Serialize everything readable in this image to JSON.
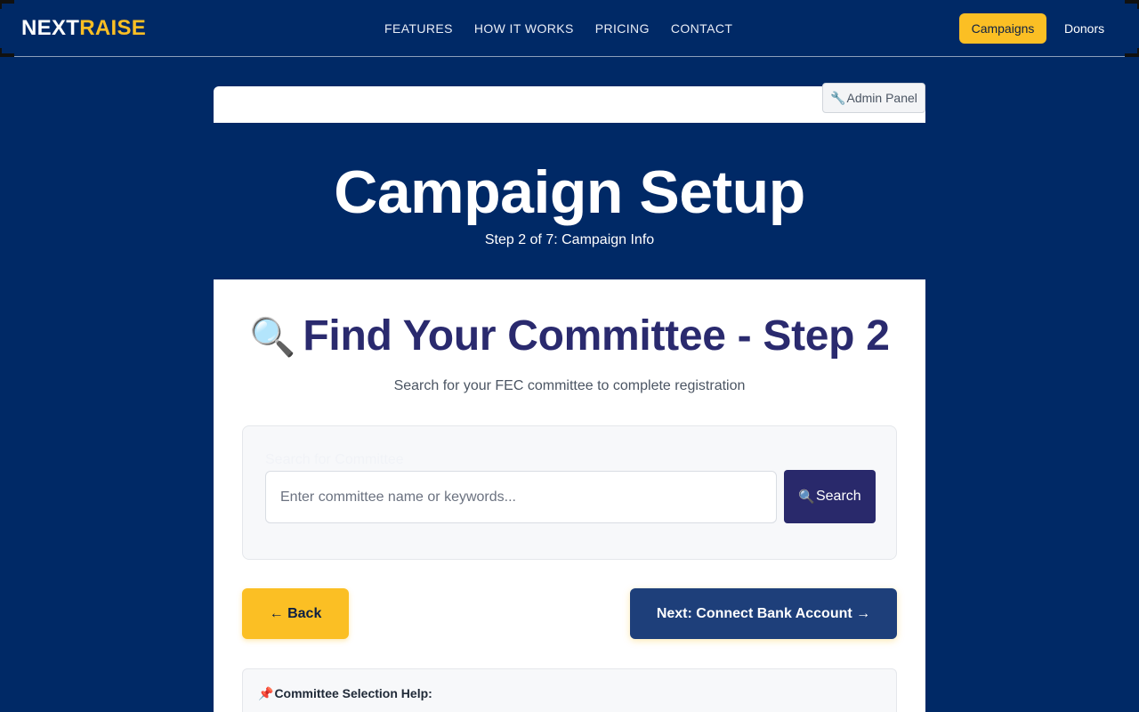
{
  "brand": {
    "part1": "NEXT",
    "part2": "RAISE",
    "accent": "#fbbf24",
    "bg": "#002966"
  },
  "nav": {
    "links": [
      "FEATURES",
      "HOW IT WORKS",
      "PRICING",
      "CONTACT"
    ],
    "campaigns_label": "Campaigns",
    "donors_label": "Donors"
  },
  "admin": {
    "icon": "wrench-icon",
    "label": "Admin Panel"
  },
  "hero": {
    "title": "Campaign Setup",
    "subtitle": "Step 2 of 7: Campaign Info"
  },
  "card": {
    "title_icon": "magnifier-icon",
    "title": "Find Your Committee - Step 2",
    "subtitle": "Search for your FEC committee to complete registration",
    "search": {
      "label": "Search for Committee",
      "placeholder": "Enter committee name or keywords...",
      "value": "",
      "button_label": "Search"
    },
    "back_label": "← Back",
    "next_label": "Next: Connect Bank Account →",
    "help": {
      "icon": "pushpin-icon",
      "title": "Committee Selection Help:"
    }
  }
}
